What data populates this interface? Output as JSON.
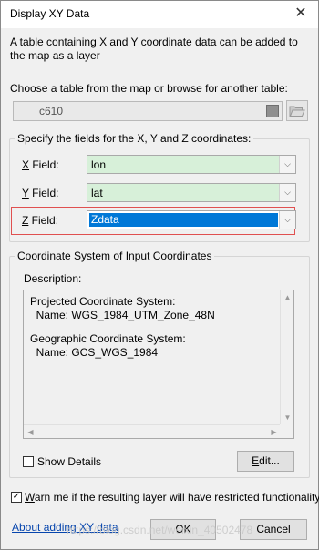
{
  "window": {
    "title": "Display XY Data",
    "close_symbol": "✕"
  },
  "intro_text": "A table containing X and Y coordinate data can be added to the map as a layer",
  "table_section": {
    "label": "Choose a table from the map or browse for another table:",
    "selected_table": "c610"
  },
  "fields_group": {
    "title": "Specify the fields for the X, Y and Z coordinates:",
    "x": {
      "label_key": "X",
      "label_rest": " Field:",
      "value": "lon"
    },
    "y": {
      "label_key": "Y",
      "label_rest": " Field:",
      "value": "lat"
    },
    "z": {
      "label_key": "Z",
      "label_rest": " Field:",
      "value": "Zdata"
    },
    "dropdown_arrow": "⌵"
  },
  "coord_group": {
    "title": "Coordinate System of Input Coordinates",
    "description_label": "Description:",
    "description_lines": [
      "Projected Coordinate System:",
      "  Name: WGS_1984_UTM_Zone_48N",
      "",
      "Geographic Coordinate System:",
      "  Name: GCS_WGS_1984"
    ],
    "show_details_label": "Show Details",
    "edit_button": {
      "key": "E",
      "rest": "dit..."
    }
  },
  "warn": {
    "key": "W",
    "rest": "arn me if the resulting layer will have restricted functionality",
    "checked": true,
    "check_symbol": "✓"
  },
  "footer": {
    "help_link": "About adding XY data",
    "ok_label": "OK",
    "cancel_label": "Cancel"
  },
  "watermark": "https://blog.csdn.net/weixin_40502478"
}
